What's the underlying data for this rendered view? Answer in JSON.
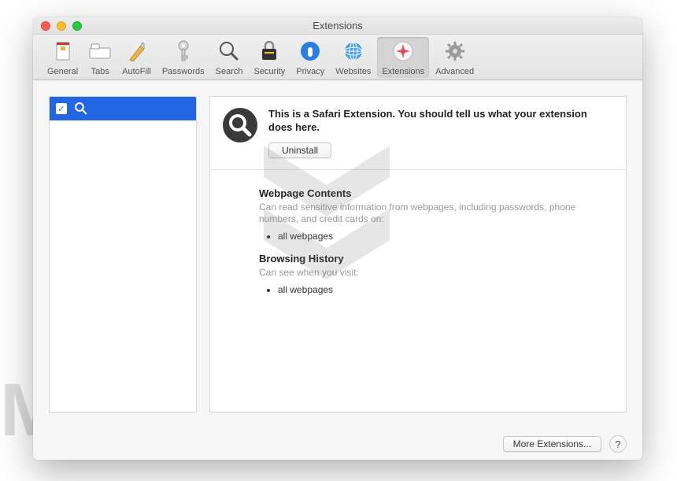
{
  "window": {
    "title": "Extensions"
  },
  "toolbar": {
    "items": [
      {
        "label": "General"
      },
      {
        "label": "Tabs"
      },
      {
        "label": "AutoFill"
      },
      {
        "label": "Passwords"
      },
      {
        "label": "Search"
      },
      {
        "label": "Security"
      },
      {
        "label": "Privacy"
      },
      {
        "label": "Websites"
      },
      {
        "label": "Extensions"
      },
      {
        "label": "Advanced"
      }
    ]
  },
  "sidebar": {
    "items": [
      {
        "checked": true
      }
    ]
  },
  "detail": {
    "description": "This is a Safari Extension. You should tell us what your extension does here.",
    "uninstall_label": "Uninstall"
  },
  "permissions": {
    "webpage_heading": "Webpage Contents",
    "webpage_text": "Can read sensitive information from webpages, including passwords, phone numbers, and credit cards on:",
    "webpage_item": "all webpages",
    "history_heading": "Browsing History",
    "history_text": "Can see when you visit:",
    "history_item": "all webpages"
  },
  "footer": {
    "more_label": "More Extensions...",
    "help_label": "?"
  },
  "watermark": "MALWARETIPS"
}
